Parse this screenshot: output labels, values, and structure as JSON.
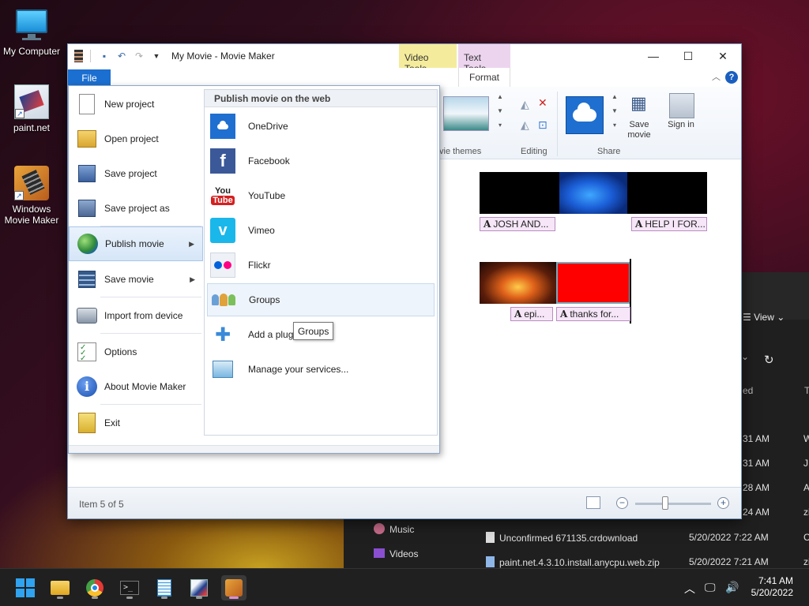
{
  "desktop": {
    "icons": [
      {
        "label": "My Computer"
      },
      {
        "label": "paint.net"
      },
      {
        "label": "Windows Movie Maker"
      }
    ]
  },
  "explorer_bg": {
    "view_label": "View",
    "col_header": "ed",
    "col_header2": "T",
    "times": [
      "31 AM",
      "31 AM",
      "28 AM",
      "24 AM"
    ],
    "times_suffix": [
      "W",
      "JP",
      "A",
      "zi"
    ],
    "sidebar": [
      {
        "label": "Music"
      },
      {
        "label": "Videos"
      }
    ],
    "files": [
      {
        "name": "Unconfirmed 671135.crdownload",
        "date": "5/20/2022 7:22 AM",
        "type": "C"
      },
      {
        "name": "paint.net.4.3.10.install.anycpu.web.zip",
        "date": "5/20/2022 7:21 AM",
        "type": "zi"
      }
    ]
  },
  "window": {
    "title": "My Movie - Movie Maker",
    "context_tabs": {
      "video_tools": "Video Tools",
      "text_tools": "Text Tools"
    },
    "tabs": {
      "file": "File",
      "format": "Format"
    },
    "ribbon_groups": {
      "themes": "vie themes",
      "editing": "Editing",
      "share": "Share"
    },
    "buttons": {
      "save_movie": "Save movie",
      "sign_in": "Sign in"
    },
    "status": {
      "item_count": "Item 5 of 5"
    },
    "captions": [
      "JOSH AND...",
      "HELP I FOR...",
      "epi...",
      "thanks for..."
    ],
    "caption_glyph": "A",
    "accent": "#1b6fd0"
  },
  "file_menu": {
    "items": [
      {
        "label": "New project"
      },
      {
        "label": "Open project"
      },
      {
        "label": "Save project"
      },
      {
        "label": "Save project as"
      },
      {
        "label": "Publish movie"
      },
      {
        "label": "Save movie"
      },
      {
        "label": "Import from device"
      },
      {
        "label": "Options"
      },
      {
        "label": "About Movie Maker"
      },
      {
        "label": "Exit"
      }
    ],
    "submenu": {
      "header": "Publish movie on the web",
      "items": [
        {
          "label": "OneDrive"
        },
        {
          "label": "Facebook"
        },
        {
          "label": "YouTube"
        },
        {
          "label": "Vimeo"
        },
        {
          "label": "Flickr"
        },
        {
          "label": "Groups"
        },
        {
          "label": "Add a plug"
        },
        {
          "label": "Manage your services..."
        }
      ]
    },
    "tooltip": "Groups"
  },
  "taskbar": {
    "time": "7:41 AM",
    "date": "5/20/2022"
  }
}
